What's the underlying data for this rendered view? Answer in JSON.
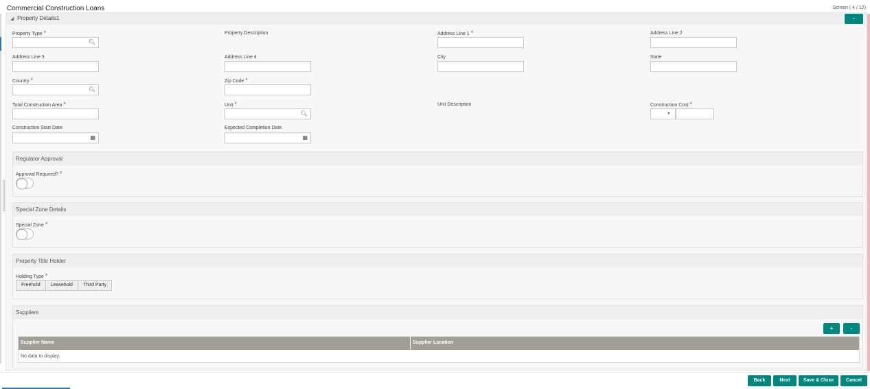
{
  "app": {
    "title": "Commercial Construction Loans",
    "screen_info": "Screen ( 4 / 12)"
  },
  "panel": {
    "title": "Property Details1",
    "collapse_label": "-"
  },
  "fields": {
    "property_type": "Property Type",
    "property_description": "Property Description",
    "address_line_1": "Address Line 1",
    "address_line_2": "Address Line 2",
    "address_line_3": "Address Line 3",
    "address_line_4": "Address Line 4",
    "city": "City",
    "state": "State",
    "country": "Country",
    "zip_code": "Zip Code",
    "total_construction_area": "Total Construction Area",
    "unit": "Unit",
    "unit_description": "Unit Description",
    "construction_cost": "Construction Cost",
    "construction_start_date": "Construction Start Date",
    "expected_completion_date": "Expected Completion Date",
    "required_mark": "*"
  },
  "regulator_approval": {
    "title": "Regulator Approval",
    "approval_required_label": "Approval Required?"
  },
  "special_zone": {
    "title": "Special Zone Details",
    "special_zone_label": "Special Zone"
  },
  "title_holder": {
    "title": "Property Title Holder",
    "holding_type_label": "Holding Type",
    "options": [
      "Freehold",
      "Leasehold",
      "Third Party"
    ]
  },
  "suppliers": {
    "title": "Suppliers",
    "add_label": "+",
    "remove_label": "-",
    "columns": [
      "Supplier Name",
      "Supplier Location"
    ],
    "empty_text": "No data to display."
  },
  "footer": {
    "back": "Back",
    "next": "Next",
    "save_close": "Save & Close",
    "cancel": "Cancel"
  },
  "icons": {
    "search": "search-icon",
    "calendar": "calendar-icon",
    "dropdown": "chevron-down-icon",
    "collapse": "triangle-collapse-icon"
  },
  "colors": {
    "accent": "#00877e",
    "required": "#2a76b8",
    "grid_header": "#a09e97"
  }
}
